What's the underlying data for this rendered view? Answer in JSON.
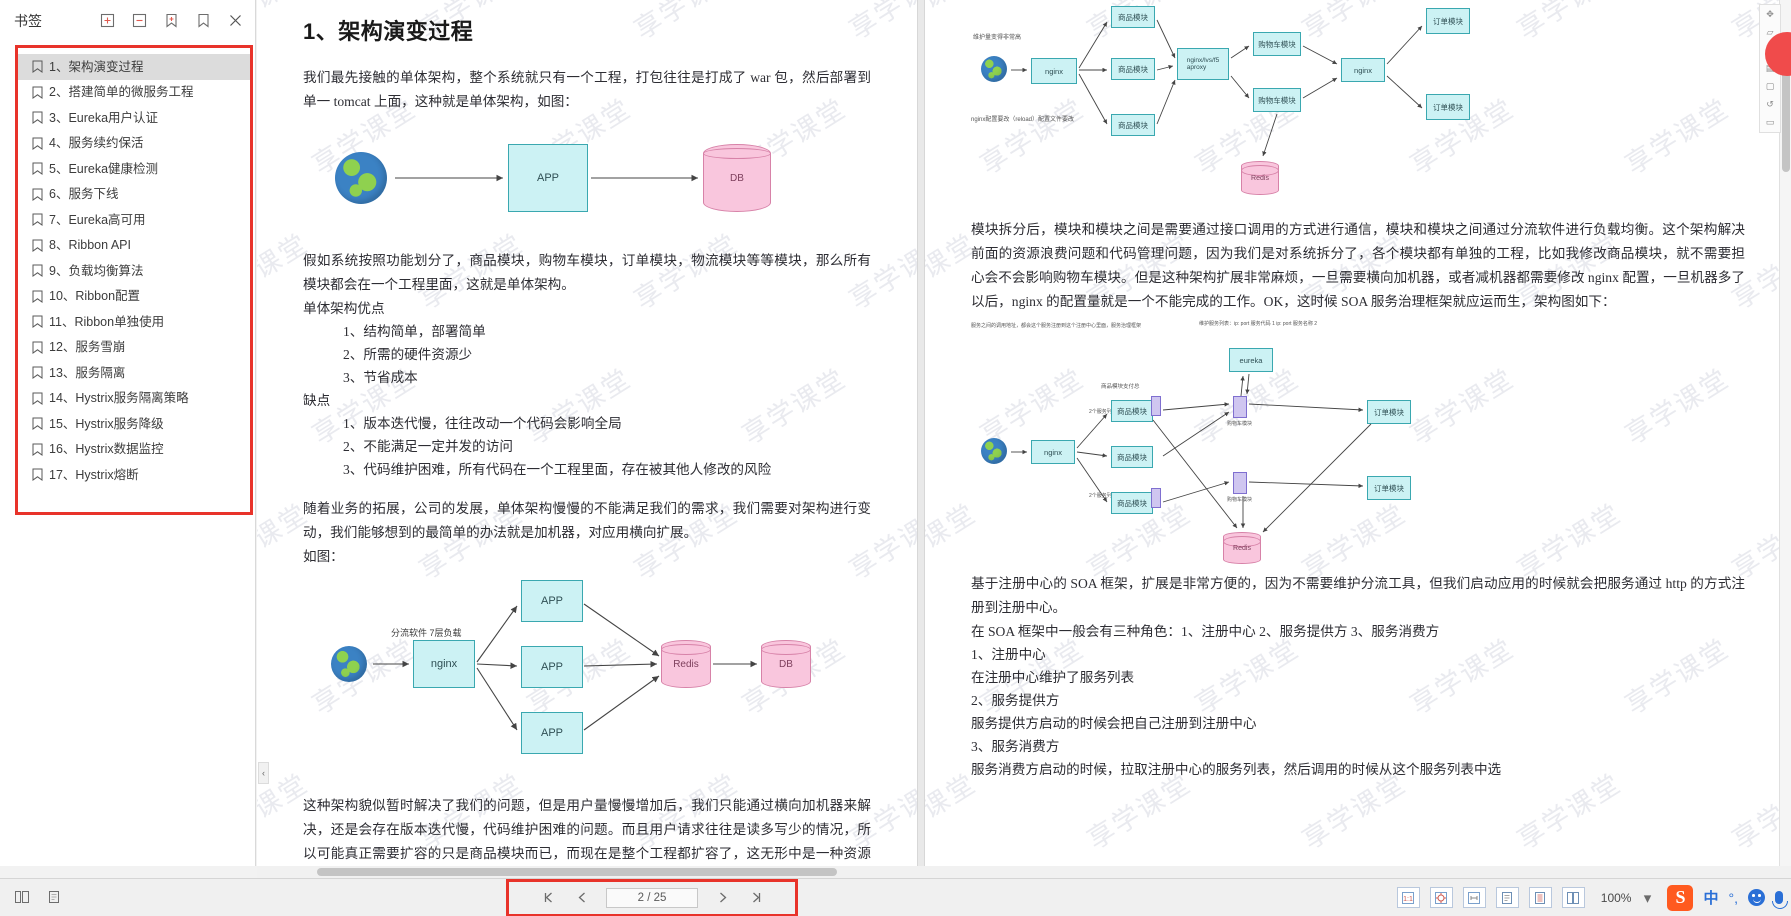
{
  "sidebar": {
    "title": "书签",
    "tools": [
      {
        "name": "expand-all-icon",
        "glyph": "expand"
      },
      {
        "name": "collapse-all-icon",
        "glyph": "collapse"
      },
      {
        "name": "add-bookmark-icon",
        "glyph": "add"
      },
      {
        "name": "bookmark-icon",
        "glyph": "bookmark"
      },
      {
        "name": "close-panel-icon",
        "glyph": "close"
      }
    ],
    "bookmarks": [
      {
        "label": "1、架构演变过程",
        "selected": true
      },
      {
        "label": "2、搭建简单的微服务工程",
        "selected": false
      },
      {
        "label": "3、Eureka用户认证",
        "selected": false
      },
      {
        "label": "4、服务续约保活",
        "selected": false
      },
      {
        "label": "5、Eureka健康检测",
        "selected": false
      },
      {
        "label": "6、服务下线",
        "selected": false
      },
      {
        "label": "7、Eureka高可用",
        "selected": false
      },
      {
        "label": "8、Ribbon API",
        "selected": false
      },
      {
        "label": "9、负载均衡算法",
        "selected": false
      },
      {
        "label": "10、Ribbon配置",
        "selected": false
      },
      {
        "label": "11、Ribbon单独使用",
        "selected": false
      },
      {
        "label": "12、服务雪崩",
        "selected": false
      },
      {
        "label": "13、服务隔离",
        "selected": false
      },
      {
        "label": "14、Hystrix服务隔离策略",
        "selected": false
      },
      {
        "label": "15、Hystrix服务降级",
        "selected": false
      },
      {
        "label": "16、Hystrix数据监控",
        "selected": false
      },
      {
        "label": "17、Hystrix熔断",
        "selected": false
      }
    ]
  },
  "document": {
    "watermark_text": "享学课堂",
    "left_page": {
      "heading": "1、架构演变过程",
      "para1": "我们最先接触的单体架构，整个系统就只有一个工程，打包往往是打成了 war 包，然后部署到单一 tomcat 上面，这种就是单体架构，如图：",
      "diagram1": {
        "nodes": [
          {
            "label": "APP",
            "type": "box"
          },
          {
            "label": "DB",
            "type": "cylinder"
          }
        ],
        "globe": "internet-globe"
      },
      "para2": "假如系统按照功能划分了，商品模块，购物车模块，订单模块，物流模块等等模块，那么所有模块都会在一个工程里面，这就是单体架构。",
      "pros_title": "单体架构优点",
      "pros": [
        "1、结构简单，部署简单",
        "2、所需的硬件资源少",
        "3、节省成本"
      ],
      "cons_title": "缺点",
      "cons": [
        "1、版本迭代慢，往往改动一个代码会影响全局",
        "2、不能满足一定并发的访问",
        "3、代码维护困难，所有代码在一个工程里面，存在被其他人修改的风险"
      ],
      "para3": "随着业务的拓展，公司的发展，单体架构慢慢的不能满足我们的需求，我们需要对架构进行变动，我们能够想到的最简单的办法就是加机器，对应用横向扩展。",
      "para3_tail": "如图：",
      "diagram2": {
        "caption": "分流软件 7层负载",
        "nodes": [
          "nginx",
          "APP",
          "APP",
          "APP",
          "Redis",
          "DB"
        ]
      },
      "para4": "这种架构貌似暂时解决了我们的问题，但是用户量慢慢增加后，我们只能通过横向加机器来解决，还是会存在版本迭代慢，代码维护困难的问题。而且用户请求往往是读多写少的情况，所以可能真正需要扩容的只是商品模块而已，而现在是整个工程都扩容了，这无形中是一种资源的浪费，因为其他模块可能根本不需要扩容就可以满足需求。所以我们有必要对整个工程按照模块进行拆分，拆分后的架构图如下："
    },
    "right_page": {
      "diagram3": {
        "label_nginx_note": "nginx配置要改（reload）配置文件要改",
        "label_maintain": "维护量变得非常高",
        "nodes": [
          "nginx",
          "商品模块",
          "商品模块",
          "商品模块",
          "商品模块",
          "nginx/lvs/f5 aproxy",
          "购物车模块",
          "购物车模块",
          "nginx",
          "订单模块",
          "订单模块",
          "Redis"
        ]
      },
      "para1": "模块拆分后，模块和模块之间是需要通过接口调用的方式进行通信，模块和模块之间通过分流软件进行负载均衡。这个架构解决前面的资源浪费问题和代码管理问题，因为我们是对系统拆分了，各个模块都有单独的工程，比如我修改商品模块，就不需要担心会不会影响购物车模块。但是这种架构扩展非常麻烦，一旦需要横向加机器，或者减机器都需要修改 nginx 配置，一旦机器多了以后，nginx 的配置量就是一个不能完成的工作。OK，这时候 SOA 服务治理框架就应运而生，架构图如下：",
      "diagram4": {
        "note_left": "服务之间的调用地址，都会这个服务注册到这个注册中心里面，服务治理框架",
        "note_right": "维护服务列表：ip: port 服务代码 1   ip: port 服务名称 2",
        "nodes": [
          "eureka",
          "nginx",
          "商品模块",
          "商品模块",
          "商品模块",
          "购物车模块",
          "购物车模块",
          "订单模块",
          "订单模块",
          "Redis"
        ],
        "left_label": "2个服务列表",
        "left_label2": "2个服务列表",
        "top_label": "商品模块支付总"
      },
      "para2": "基于注册中心的 SOA 框架，扩展是非常方便的，因为不需要维护分流工具，但我们启动应用的时候就会把服务通过 http 的方式注册到注册中心。",
      "para3": "在 SOA 框架中一般会有三种角色：1、注册中心 2、服务提供方 3、服务消费方",
      "role1": "1、注册中心",
      "role1_desc": "在注册中心维护了服务列表",
      "role2": "2、服务提供方",
      "role2_desc": "服务提供方启动的时候会把自己注册到注册中心",
      "role3": "3、服务消费方",
      "role3_desc": "服务消费方启动的时候，拉取注册中心的服务列表，然后调用的时候从这个服务列表中选"
    }
  },
  "bottom_bar": {
    "left_tools": [
      {
        "name": "thumbnail-panel-icon"
      },
      {
        "name": "page-layout-icon"
      }
    ],
    "nav": {
      "first_page_icon": "first-page-icon",
      "prev_page_icon": "prev-page-icon",
      "page_value": "2 / 25",
      "next_page_icon": "next-page-icon",
      "last_page_icon": "last-page-icon"
    },
    "view_tools": [
      {
        "name": "actual-size-icon",
        "glyph": "1:1"
      },
      {
        "name": "fit-page-icon",
        "glyph": "fit"
      },
      {
        "name": "fit-width-icon",
        "glyph": "width"
      },
      {
        "name": "single-page-icon",
        "glyph": "single"
      },
      {
        "name": "continuous-page-icon",
        "glyph": "cont"
      },
      {
        "name": "facing-page-icon",
        "glyph": "facing"
      }
    ],
    "zoom_level": "100%",
    "ime": {
      "logo": "S",
      "lang": "中",
      "punct": "°,",
      "emoji_icon": "emoji-icon",
      "mic_icon": "microphone-icon"
    }
  }
}
